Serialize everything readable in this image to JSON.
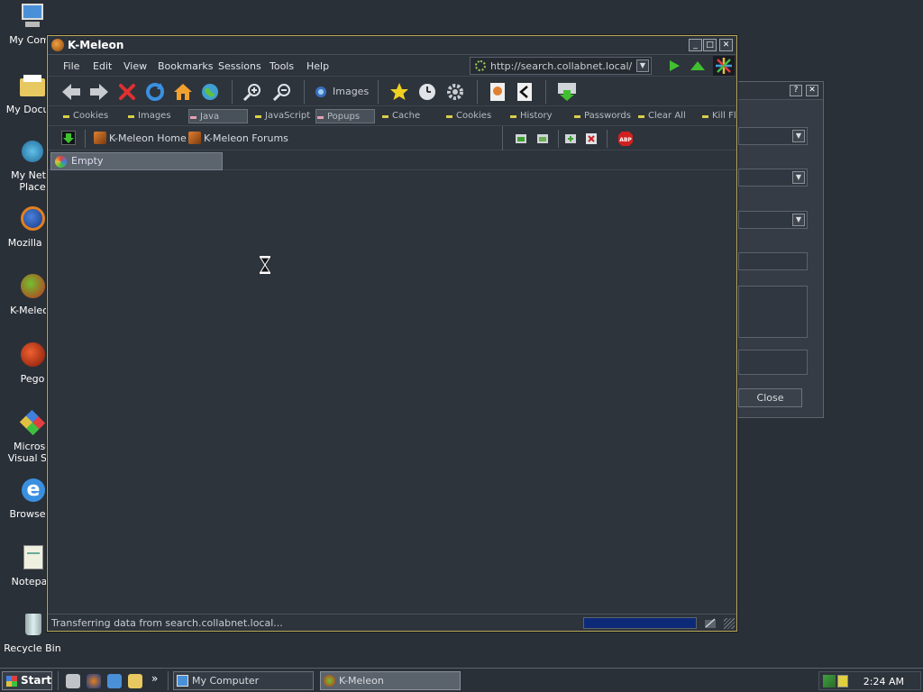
{
  "desktop": {
    "icons": [
      {
        "label": "My Comp"
      },
      {
        "label": "My Docum"
      },
      {
        "label": "My Netw\nPlace"
      },
      {
        "label": "Mozilla Fir"
      },
      {
        "label": "K-Meleon"
      },
      {
        "label": "Pego"
      },
      {
        "label": "Microso\nVisual Stu"
      },
      {
        "label": "Browserv"
      },
      {
        "label": "Notepad"
      },
      {
        "label": "Recycle Bin"
      }
    ]
  },
  "background_dialog": {
    "help_btn": "?",
    "close_btn": "✕",
    "close_label": "Close"
  },
  "browser": {
    "title": "K-Meleon",
    "menu": [
      "File",
      "Edit",
      "View",
      "Bookmarks",
      "Sessions",
      "Tools",
      "Help"
    ],
    "url": "http://search.collabnet.local/",
    "images_label": "Images",
    "privacy_bar": [
      "Cookies",
      "Images",
      "Java",
      "JavaScript",
      "Popups",
      "Cache",
      "Cookies",
      "History",
      "Passwords",
      "Clear All",
      "Kill Fl"
    ],
    "bookmarks": [
      "K-Meleon Home",
      "K-Meleon Forums"
    ],
    "tab_label": "Empty",
    "status_text": "Transferring data from search.collabnet.local...",
    "progress": 1.0
  },
  "taskbar": {
    "start_label": "Start",
    "more": "»",
    "tasks": [
      "My Computer",
      "K-Meleon"
    ],
    "clock": "2:24 AM"
  }
}
